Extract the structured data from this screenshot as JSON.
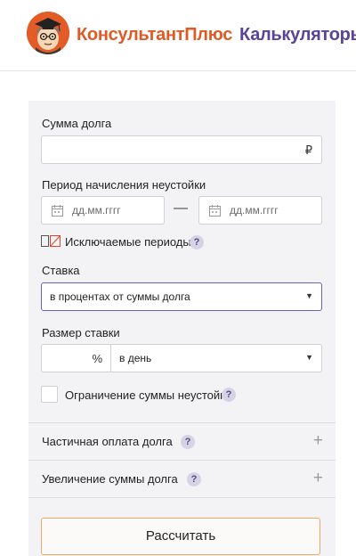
{
  "header": {
    "brand_main": "КонсультантПлюс",
    "brand_sub": "Калькуляторы",
    "colors": {
      "brand_orange": "#e05a25",
      "brand_purple": "#5b4397"
    }
  },
  "form": {
    "debt_label": "Сумма долга",
    "debt_value": "",
    "currency_sign": "₽",
    "period_label": "Период начисления неустойки",
    "date_from_placeholder": "дд.мм.гггг",
    "date_to_placeholder": "дд.мм.гггг",
    "date_separator": "—",
    "excluded_periods_label": "Исключаемые периоды",
    "help_glyph": "?",
    "rate_label": "Ставка",
    "rate_selected": "в процентах от суммы долга",
    "rate_size_label": "Размер ставки",
    "rate_size_value": "",
    "percent_sign": "%",
    "rate_period_selected": "в день",
    "limit_label": "Ограничение суммы неустойки",
    "limit_checked": false,
    "select_caret": "▼"
  },
  "accordions": [
    {
      "label": "Частичная оплата долга",
      "plus": "+"
    },
    {
      "label": "Увеличение суммы долга",
      "plus": "+"
    }
  ],
  "actions": {
    "calculate_label": "Рассчитать"
  },
  "colors": {
    "panel_bg": "#f3f3f5",
    "select_focus_border": "#6a64b8",
    "button_border": "#f0a76a",
    "help_bg": "#d6d3e7"
  }
}
